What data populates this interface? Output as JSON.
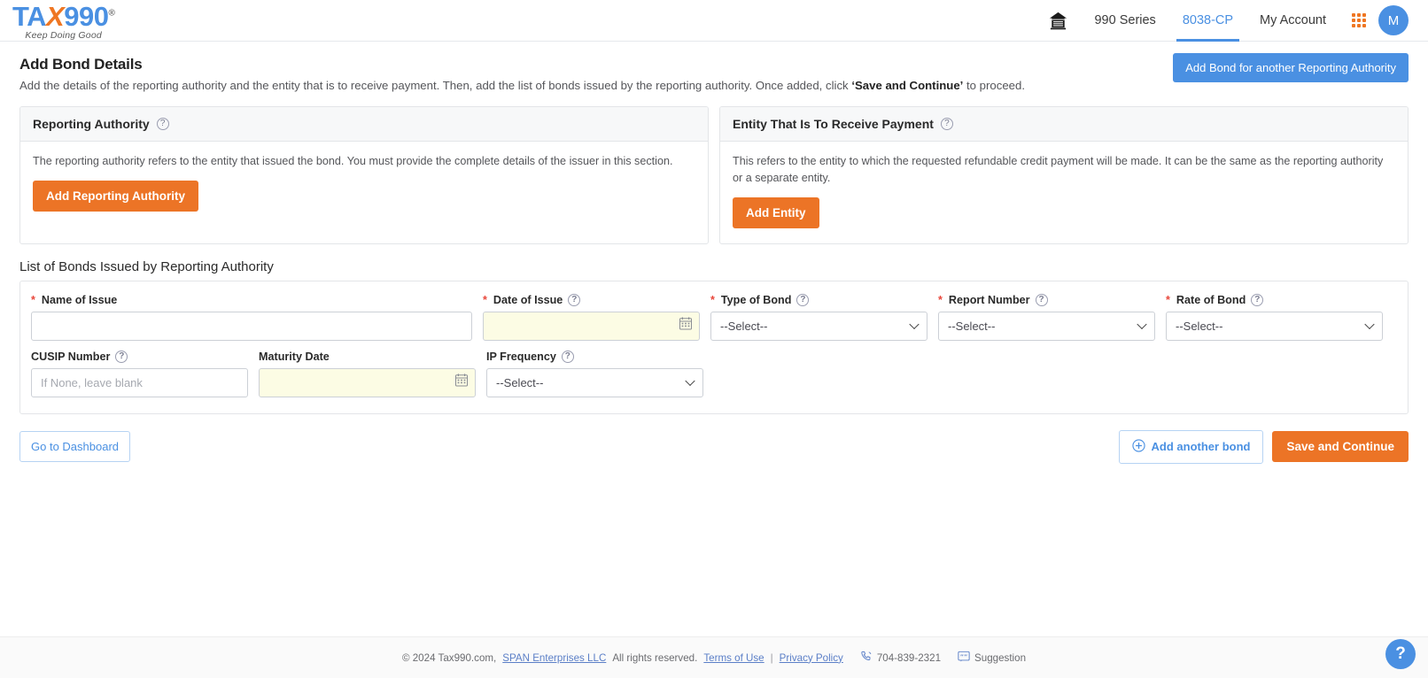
{
  "header": {
    "logo_text": "TA",
    "logo_x": "X",
    "logo_tail": "990",
    "logo_reg": "®",
    "logo_tagline": "Keep Doing Good",
    "home_icon": "bank-home-icon",
    "nav": [
      {
        "label": "990 Series",
        "active": false
      },
      {
        "label": "8038-CP",
        "active": true
      },
      {
        "label": "My Account",
        "active": false
      }
    ],
    "apps_icon": "grid-apps-icon",
    "avatar_initial": "M",
    "accent_blue": "#4a90e2",
    "accent_orange": "#ef7622"
  },
  "page": {
    "title": "Add Bond Details",
    "subtitle_part1": "Add the details of the reporting authority and the entity that is to receive payment. Then, add the list of bonds issued by the reporting authority. Once added, click ",
    "subtitle_bold": "‘Save and Continue’",
    "subtitle_part2": " to proceed.",
    "add_bond_another_authority_label": "Add Bond for another Reporting Authority"
  },
  "panels": [
    {
      "title": "Reporting Authority",
      "help_icon": "question-mark-icon",
      "text": "The reporting authority refers to the entity that issued the bond. You must provide the complete details of the issuer in this section.",
      "button_label": "Add Reporting Authority"
    },
    {
      "title": "Entity That Is To Receive Payment",
      "help_icon": "question-mark-icon",
      "text": "This refers to the entity to which the requested refundable credit payment will be made. It can be the same as the reporting authority or a separate entity.",
      "button_label": "Add Entity"
    }
  ],
  "bonds": {
    "section_title": "List of Bonds Issued by Reporting Authority",
    "fields": {
      "name_of_issue": {
        "label": "Name of Issue",
        "required": true,
        "has_help": false,
        "value": "",
        "placeholder": ""
      },
      "date_of_issue": {
        "label": "Date of Issue",
        "required": true,
        "has_help": true,
        "value": "",
        "placeholder": "",
        "icon": "calendar-icon"
      },
      "type_of_bond": {
        "label": "Type of Bond",
        "required": true,
        "has_help": true,
        "value": "--Select--"
      },
      "report_number": {
        "label": "Report Number",
        "required": true,
        "has_help": true,
        "value": "--Select--"
      },
      "rate_of_bond": {
        "label": "Rate of Bond",
        "required": true,
        "has_help": true,
        "value": "--Select--"
      },
      "cusip_number": {
        "label": "CUSIP Number",
        "required": false,
        "has_help": true,
        "value": "",
        "placeholder": "If None, leave blank"
      },
      "maturity_date": {
        "label": "Maturity Date",
        "required": false,
        "has_help": false,
        "value": "",
        "placeholder": "",
        "icon": "calendar-icon"
      },
      "ip_frequency": {
        "label": "IP Frequency",
        "required": false,
        "has_help": true,
        "value": "--Select--"
      }
    }
  },
  "actions": {
    "go_to_dashboard": "Go to Dashboard",
    "add_another_bond": "Add another bond",
    "add_icon": "plus-circle-icon",
    "save_and_continue": "Save and Continue"
  },
  "footer": {
    "copyright": "© 2024 Tax990.com,",
    "company_link": "SPAN Enterprises LLC",
    "rights": "All rights reserved.",
    "terms_link": "Terms of Use",
    "separator": "|",
    "privacy_link": "Privacy Policy",
    "phone_icon": "phone-icon",
    "phone": "704-839-2321",
    "suggestion_icon": "quote-icon",
    "suggestion": "Suggestion",
    "help_fab": "?"
  }
}
